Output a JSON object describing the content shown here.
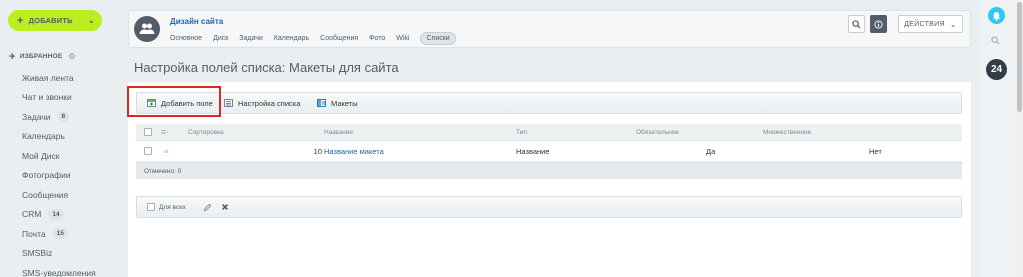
{
  "sidebar": {
    "add_label": "ДОБАВИТЬ",
    "favorites_label": "ИЗБРАННОЕ",
    "items": [
      {
        "label": "Живая лента",
        "count": ""
      },
      {
        "label": "Чат и звонки",
        "count": ""
      },
      {
        "label": "Задачи",
        "count": "8"
      },
      {
        "label": "Календарь",
        "count": ""
      },
      {
        "label": "Мой Диск",
        "count": ""
      },
      {
        "label": "Фотографии",
        "count": ""
      },
      {
        "label": "Сообщения",
        "count": ""
      },
      {
        "label": "CRM",
        "count": "14"
      },
      {
        "label": "Почта",
        "count": "15"
      },
      {
        "label": "SMSBiz",
        "count": ""
      },
      {
        "label": "SMS-уведомления",
        "count": ""
      }
    ]
  },
  "header": {
    "group_title": "Дизайн сайта",
    "nav": [
      "Основное",
      "Диск",
      "Задачи",
      "Календарь",
      "Сообщения",
      "Фото",
      "Wiki",
      "Списки"
    ],
    "active_nav": "Списки",
    "actions_label": "ДЕЙСТВИЯ"
  },
  "right_panel": {
    "counter": "24"
  },
  "page": {
    "title": "Настройка полей списка: Макеты для сайта"
  },
  "toolbar": {
    "add_field": "Добавить поле",
    "list_settings": "Настройка списка",
    "layouts": "Макеты"
  },
  "grid": {
    "columns": {
      "sort": "Сортировка",
      "name": "Название",
      "type": "Тип",
      "required": "Обязательное",
      "multiple": "Множественное"
    },
    "rows": [
      {
        "sort": "10",
        "name": "Название макета",
        "type": "Название",
        "required": "Да",
        "multiple": "Нет"
      }
    ],
    "footer": "Отмечено: 0",
    "for_all": "Для всех"
  },
  "colors": {
    "add_button": "#bbed21",
    "link": "#2067b0",
    "highlight": "#e02525",
    "bell": "#2fc6f6"
  }
}
